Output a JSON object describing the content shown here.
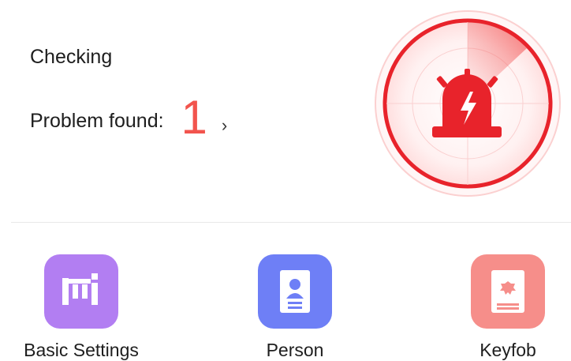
{
  "status": {
    "title": "Checking",
    "problem_label": "Problem found:",
    "problem_count": "1",
    "chevron_glyph": "›"
  },
  "alarm": {
    "icon": "siren-icon",
    "accent_color": "#e8232b"
  },
  "tiles": [
    {
      "label": "Basic Settings",
      "icon": "basic-settings-icon",
      "color": "#b27ef2"
    },
    {
      "label": "Person",
      "icon": "person-card-icon",
      "color": "#6e7ff6"
    },
    {
      "label": "Keyfob",
      "icon": "keyfob-icon",
      "color": "#f68e8a"
    }
  ]
}
